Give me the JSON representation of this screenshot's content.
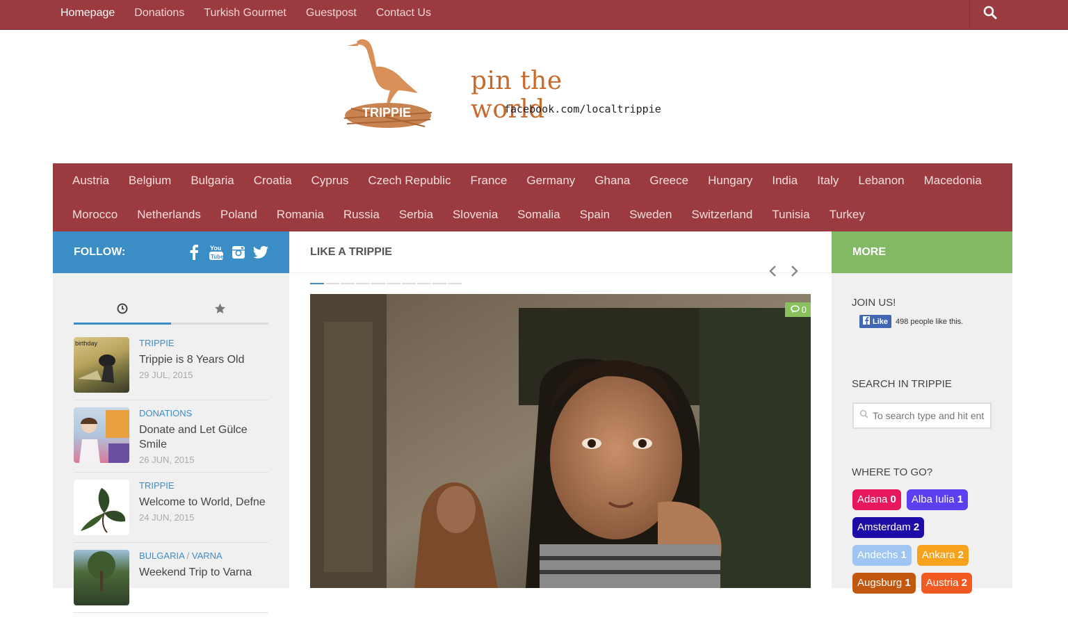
{
  "topnav": {
    "items": [
      {
        "label": "Homepage"
      },
      {
        "label": "Donations"
      },
      {
        "label": "Turkish Gourmet"
      },
      {
        "label": "Guestpost"
      },
      {
        "label": "Contact Us"
      }
    ]
  },
  "logo": {
    "title": "pin the world",
    "subtitle": "facebook.com/localtrippie",
    "badge": "TRIPPIE"
  },
  "countries": {
    "row1": [
      "Austria",
      "Belgium",
      "Bulgaria",
      "Croatia",
      "Cyprus",
      "Czech Republic",
      "France",
      "Germany",
      "Ghana",
      "Greece",
      "Hungary",
      "India",
      "Italy",
      "Lebanon",
      "Macedonia"
    ],
    "row2": [
      "Morocco",
      "Netherlands",
      "Poland",
      "Romania",
      "Russia",
      "Serbia",
      "Slovenia",
      "Somalia",
      "Spain",
      "Sweden",
      "Switzerland",
      "Tunisia",
      "Turkey"
    ]
  },
  "follow": {
    "label": "FOLLOW:",
    "icons": [
      "facebook-icon",
      "youtube-icon",
      "instagram-icon",
      "twitter-icon"
    ]
  },
  "sidebar_tabs": [
    "clock-icon",
    "star-icon"
  ],
  "posts": [
    {
      "category": "TRIPPIE",
      "title": "Trippie is 8 Years Old",
      "date": "29 JUL, 2015"
    },
    {
      "category": "DONATIONS",
      "title": "Donate and Let Gülce Smile",
      "date": "26 JUN, 2015"
    },
    {
      "category": "TRIPPIE",
      "title": "Welcome to World, Defne",
      "date": "24 JUN, 2015"
    },
    {
      "category": "BULGARIA",
      "category2": "VARNA",
      "category_sep": "/",
      "title": "Weekend Trip to Varna",
      "date": ""
    }
  ],
  "main": {
    "title": "LIKE A TRIPPIE",
    "comment_count": "0"
  },
  "right": {
    "title": "MORE",
    "join_title": "JOIN US!",
    "fb_like": "Like",
    "fb_text": "498 people like this.",
    "search_title": "SEARCH IN TRIPPIE",
    "search_placeholder": "To search type and hit enter",
    "where_title": "WHERE TO GO?",
    "tags": [
      {
        "name": "Adana",
        "count": "0",
        "color": "#e8175d"
      },
      {
        "name": "Alba Iulia",
        "count": "1",
        "color": "#5b3ff0"
      },
      {
        "name": "Amsterdam",
        "count": "2",
        "color": "#1d0ca8"
      },
      {
        "name": "Andechs",
        "count": "1",
        "color": "#9fc6f2"
      },
      {
        "name": "Ankara",
        "count": "2",
        "color": "#f6a21c"
      },
      {
        "name": "Augsburg",
        "count": "1",
        "color": "#c2570f"
      },
      {
        "name": "Austria",
        "count": "2",
        "color": "#f35a21"
      }
    ]
  }
}
